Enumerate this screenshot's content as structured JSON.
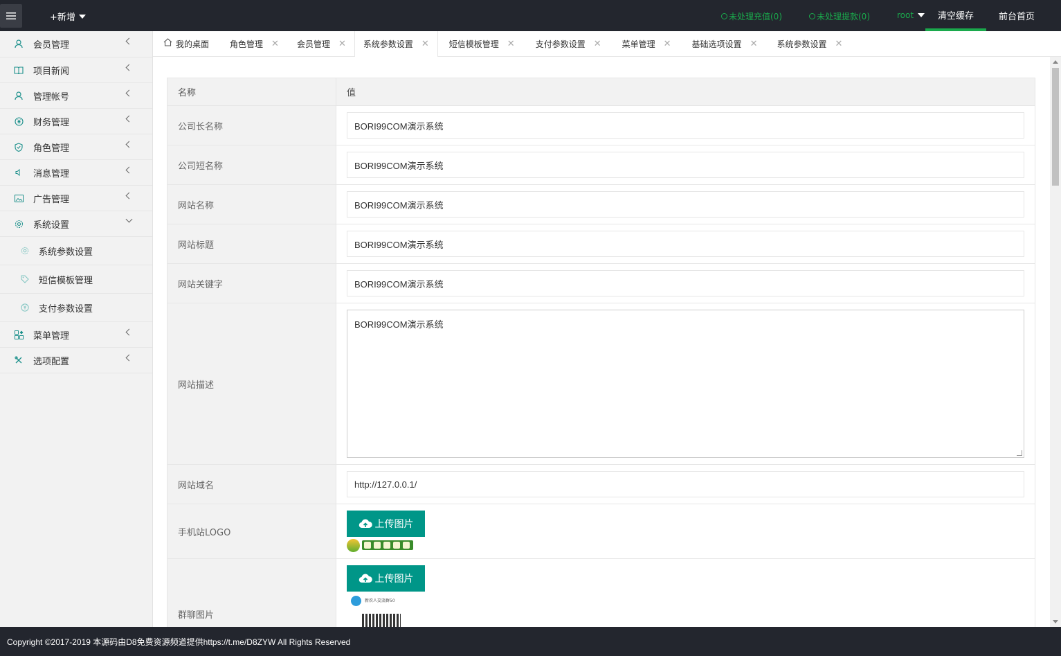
{
  "header": {
    "add_new": "+新增",
    "pending_recharge": "未处理充值(0)",
    "pending_withdraw": "未处理提款(0)",
    "user": "root",
    "clear_cache": "清空缓存",
    "front_home": "前台首页"
  },
  "sidebar": {
    "items": [
      {
        "label": "会员管理",
        "icon": "user-icon"
      },
      {
        "label": "项目新闻",
        "icon": "book-icon"
      },
      {
        "label": "管理帐号",
        "icon": "account-icon"
      },
      {
        "label": "财务管理",
        "icon": "yen-icon"
      },
      {
        "label": "角色管理",
        "icon": "shield-icon"
      },
      {
        "label": "消息管理",
        "icon": "speaker-icon"
      },
      {
        "label": "广告管理",
        "icon": "image-icon"
      },
      {
        "label": "系统设置",
        "icon": "gear-icon"
      }
    ],
    "sub_items": [
      {
        "label": "系统参数设置",
        "icon": "gear-icon"
      },
      {
        "label": "短信模板管理",
        "icon": "tag-icon"
      },
      {
        "label": "支付参数设置",
        "icon": "yen-icon"
      }
    ],
    "items_after": [
      {
        "label": "菜单管理",
        "icon": "apps-icon"
      },
      {
        "label": "选项配置",
        "icon": "tools-icon"
      }
    ]
  },
  "tabs": [
    {
      "label": "我的桌面"
    },
    {
      "label": "角色管理"
    },
    {
      "label": "会员管理"
    },
    {
      "label": "系统参数设置"
    },
    {
      "label": "短信模板管理"
    },
    {
      "label": "支付参数设置"
    },
    {
      "label": "菜单管理"
    },
    {
      "label": "基础选项设置"
    },
    {
      "label": "系统参数设置"
    }
  ],
  "table": {
    "col_name": "名称",
    "col_value": "值",
    "rows": [
      {
        "name": "公司长名称",
        "value": "BORI99COM演示系统"
      },
      {
        "name": "公司短名称",
        "value": "BORI99COM演示系统"
      },
      {
        "name": "网站名称",
        "value": "BORI99COM演示系统"
      },
      {
        "name": "网站标题",
        "value": "BORI99COM演示系统"
      },
      {
        "name": "网站关键字",
        "value": "BORI99COM演示系统"
      },
      {
        "name": "网站描述",
        "value": "BORI99COM演示系统"
      },
      {
        "name": "网站域名",
        "value": "http://127.0.0.1/"
      },
      {
        "name": "手机站LOGO",
        "value": ""
      },
      {
        "name": "群聊图片",
        "value": ""
      }
    ],
    "upload_label": "上传图片",
    "qr_caption": "新农人交流群50"
  },
  "footer": {
    "copyright": "Copyright ©2017-2019 本源码由D8免费资源频道提供https://t.me/D8ZYW All Rights Reserved"
  },
  "colors": {
    "header_bg": "#23262e",
    "accent": "#009688",
    "status_green": "#1aa94c"
  }
}
